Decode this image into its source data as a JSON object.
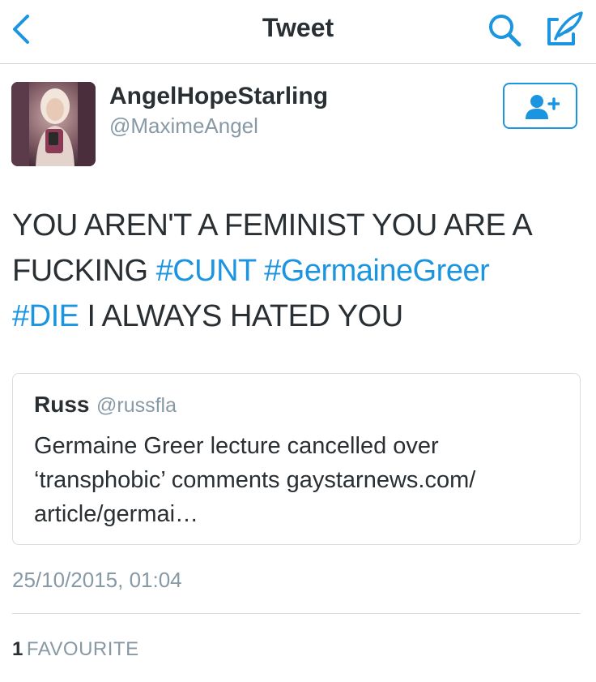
{
  "nav": {
    "title": "Tweet",
    "back_icon": "chevron-left-icon",
    "search_icon": "search-icon",
    "compose_icon": "compose-icon",
    "accent": "#1b95e0"
  },
  "author": {
    "name": "AngelHopeStarling",
    "handle": "@MaximeAngel"
  },
  "follow": {
    "icon": "add-user-icon"
  },
  "tweet": {
    "text_1": "YOU AREN'T A  FEMINIST YOU ARE A FUCKING ",
    "tag_1": "#CUNT",
    "text_2": " ",
    "tag_2": "#GermaineGreer",
    "text_3": " ",
    "tag_3": "#DIE",
    "text_4": " I ALWAYS HATED YOU"
  },
  "quote": {
    "name": "Russ",
    "handle": "@russfla",
    "text": "Germaine Greer lecture cancelled over ‘transphobic’ comments gaystarnews.com/ article/germai…"
  },
  "timestamp": "25/10/2015, 01:04",
  "stats": {
    "count": "1",
    "label": "FAVOURITE"
  }
}
